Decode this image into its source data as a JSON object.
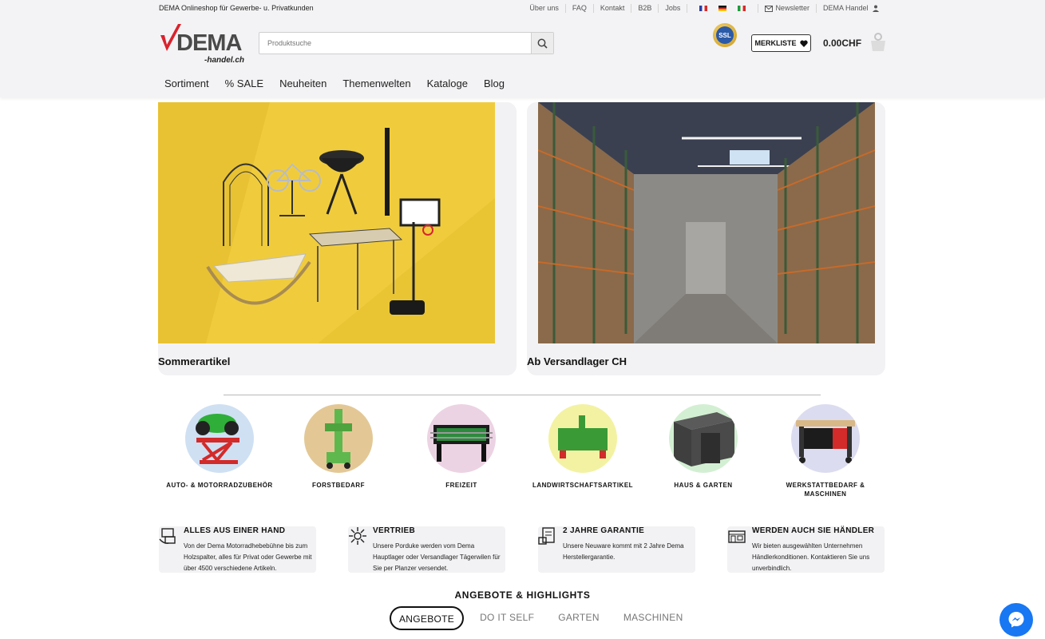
{
  "topbar": {
    "tagline": "DEMA Onlineshop für Gewerbe- u. Privatkunden",
    "links": [
      "Über uns",
      "FAQ",
      "Kontakt",
      "B2B",
      "Jobs"
    ],
    "newsletter": "Newsletter",
    "account": "DEMA Handel"
  },
  "logo": {
    "main": "DEMA",
    "sub": "-handel.ch"
  },
  "search": {
    "placeholder": "Produktsuche"
  },
  "ssl_badge": "SSL",
  "merkliste_label": "MERKLISTE",
  "cart_total": "0.00CHF",
  "nav": [
    "Sortiment",
    "% SALE",
    "Neuheiten",
    "Themenwelten",
    "Kataloge",
    "Blog"
  ],
  "hero": [
    {
      "title": "Sommerartikel"
    },
    {
      "title": "Ab Versandlager CH"
    }
  ],
  "categories": [
    {
      "label": "AUTO- & MOTORRADZUBEHÖR",
      "color": "#cfe0f3"
    },
    {
      "label": "FORSTBEDARF",
      "color": "#e3c896"
    },
    {
      "label": "FREIZEIT",
      "color": "#ecd3e3"
    },
    {
      "label": "LANDWIRTSCHAFTSARTIKEL",
      "color": "#f3f2a3"
    },
    {
      "label": "HAUS & GARTEN",
      "color": "#d3efd3"
    },
    {
      "label": "WERKSTATTBEDARF & MASCHINEN",
      "color": "#dcdcf0"
    }
  ],
  "features": [
    {
      "title": "ALLES AUS EINER HAND",
      "text": "Von der Dema Motorradhebebühne bis zum Holzspalter, alles für Privat oder Gewerbe mit über 4500 verschiedene Artikeln."
    },
    {
      "title": "VERTRIEB",
      "text": "Unsere Porduke werden vom Dema Hauptlager oder Versandlager Tägerwilen für Sie per Planzer versendet."
    },
    {
      "title": "2 JAHRE GARANTIE",
      "text": "Unsere Neuware kommt mit 2 Jahre Dema Herstellergarantie."
    },
    {
      "title": "WERDEN AUCH SIE HÄNDLER",
      "text": "Wir bieten ausgewählten Unternehmen Händlerkonditionen. Kontaktieren Sie uns unverbindlich."
    }
  ],
  "highlights": {
    "title": "ANGEBOTE & HIGHLIGHTS",
    "tabs": [
      "ANGEBOTE",
      "DO IT SELF",
      "GARTEN",
      "MASCHINEN"
    ]
  },
  "colors": {
    "accent": "#d9232d",
    "messenger": "#1877f2",
    "hero_yellow": "#efcb3c"
  }
}
